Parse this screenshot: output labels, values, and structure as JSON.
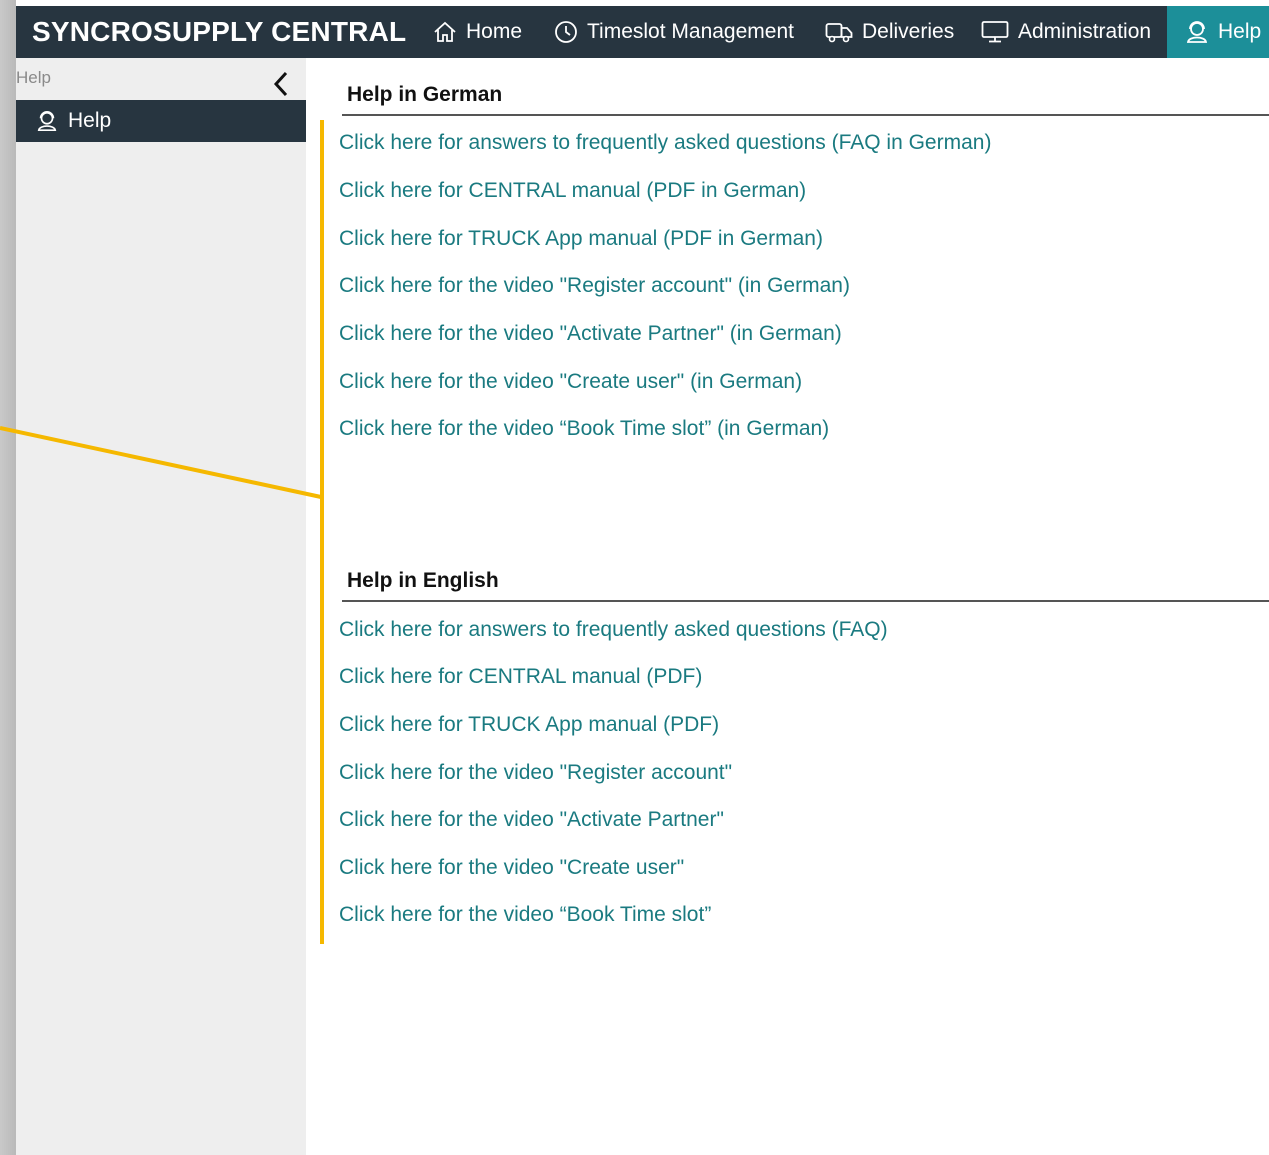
{
  "header": {
    "brand": "SYNCROSUPPLY CENTRAL",
    "nav": [
      {
        "label": "Home",
        "icon": "home-icon"
      },
      {
        "label": "Timeslot Management",
        "icon": "clock-icon"
      },
      {
        "label": "Deliveries",
        "icon": "truck-icon"
      },
      {
        "label": "Administration",
        "icon": "monitor-icon"
      },
      {
        "label": "Help",
        "icon": "help-person-icon",
        "active": true
      }
    ]
  },
  "sidebar": {
    "title": "Help",
    "collapse_icon": "chevron-left-icon",
    "items": [
      {
        "label": "Help",
        "icon": "help-person-icon",
        "active": true
      }
    ]
  },
  "main": {
    "german": {
      "heading": "Help in German",
      "links": [
        "Click here for answers to frequently asked questions (FAQ in German)",
        "Click here for CENTRAL manual (PDF in German)",
        "Click here for TRUCK App manual (PDF in German)",
        "Click here for the video \"Register account\" (in German)",
        "Click here for the video \"Activate Partner\" (in German)",
        "Click here for the video \"Create user\" (in German)",
        "Click here for the video “Book Time slot” (in German)"
      ]
    },
    "english": {
      "heading": "Help in English",
      "links": [
        "Click here for answers to frequently asked questions (FAQ)",
        "Click here for CENTRAL manual (PDF)",
        "Click here for TRUCK App manual (PDF)",
        "Click here for the video \"Register account\"",
        "Click here for the video \"Activate Partner\"",
        "Click here for the video \"Create user\"",
        "Click here for the video “Book Time slot”"
      ]
    }
  },
  "colors": {
    "nav_bg": "#273540",
    "nav_active": "#1c8f99",
    "link": "#1a7a80",
    "highlight": "#f5b800",
    "sidebar_bg": "#eeeeee"
  }
}
